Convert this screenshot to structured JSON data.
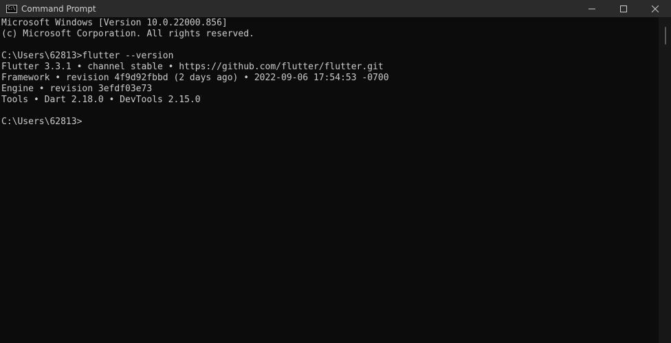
{
  "window": {
    "title": "Command Prompt",
    "icon": "cmd-icon",
    "icon_text": "C:\\"
  },
  "controls": {
    "minimize": "minimize-icon",
    "maximize": "maximize-icon",
    "close": "close-icon"
  },
  "console": {
    "lines": [
      "Microsoft Windows [Version 10.0.22000.856]",
      "(c) Microsoft Corporation. All rights reserved.",
      "",
      "C:\\Users\\62813>flutter --version",
      "Flutter 3.3.1 • channel stable • https://github.com/flutter/flutter.git",
      "Framework • revision 4f9d92fbbd (2 days ago) • 2022-09-06 17:54:53 -0700",
      "Engine • revision 3efdf03e73",
      "Tools • Dart 2.18.0 • DevTools 2.15.0",
      "",
      "C:\\Users\\62813>"
    ]
  },
  "colors": {
    "background": "#0c0c0c",
    "titlebar": "#2b2b2b",
    "text": "#cccccc"
  }
}
